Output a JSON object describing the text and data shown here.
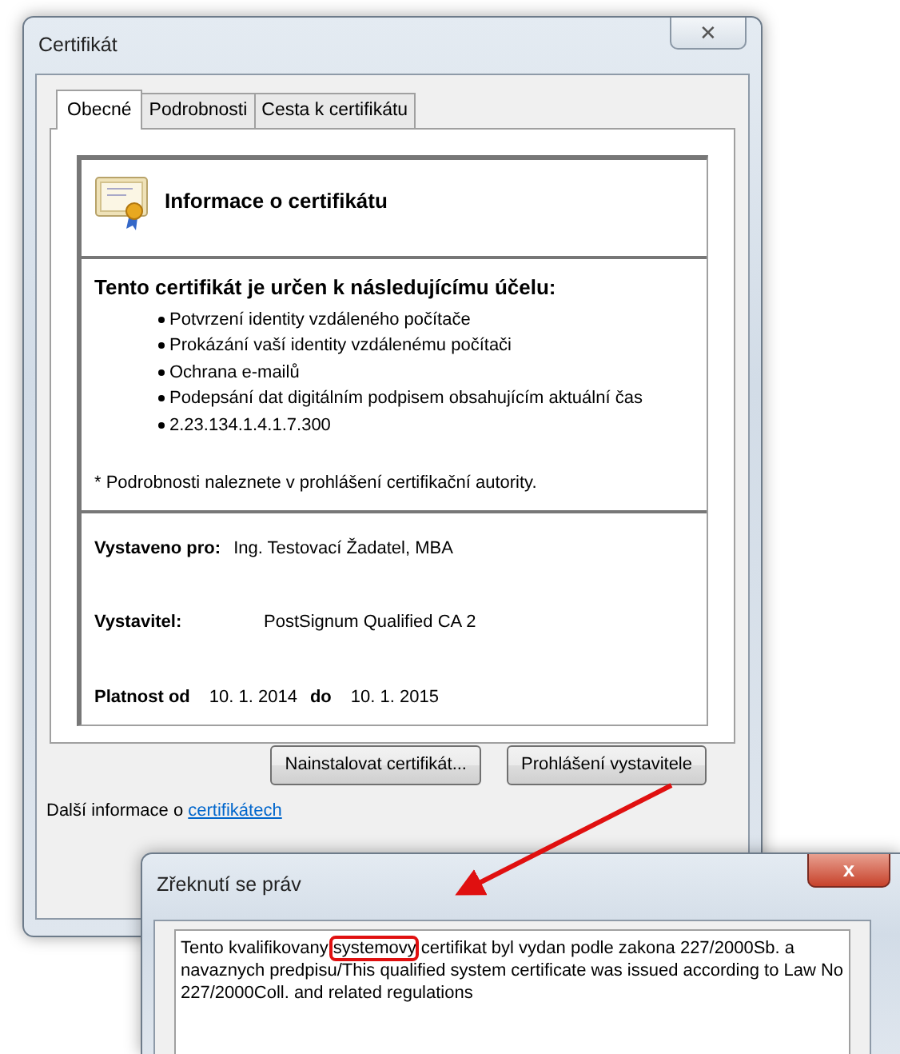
{
  "window": {
    "title": "Certifikát",
    "close": "✕"
  },
  "tabs": [
    {
      "label": "Obecné",
      "selected": true
    },
    {
      "label": "Podrobnosti",
      "selected": false
    },
    {
      "label": "Cesta k certifikátu",
      "selected": false
    }
  ],
  "info": {
    "heading": "Informace o certifikátu",
    "purpose_title": "Tento certifikát je určen k následujícímu účelu:",
    "purposes": [
      "Potvrzení identity vzdáleného počítače",
      "Prokázání vaší identity vzdálenému počítači",
      "Ochrana e-mailů",
      "Podepsání dat digitálním podpisem obsahujícím aktuální čas",
      "2.23.134.1.4.1.7.300"
    ],
    "note": "* Podrobnosti naleznete v prohlášení certifikační autority.",
    "issued_to_label": "Vystaveno pro:",
    "issued_to": "Ing. Testovací Žadatel, MBA",
    "issuer_label": "Vystavitel:",
    "issuer": "PostSignum Qualified CA 2",
    "valid_from_label": "Platnost od",
    "valid_from": "10. 1. 2014",
    "valid_to_label": "do",
    "valid_to": "10. 1. 2015"
  },
  "buttons": [
    "Nainstalovat certifikát...",
    "Prohlášení vystavitele"
  ],
  "more_info": {
    "text": "Další informace o",
    "link": "certifikátech"
  },
  "disclaimer_window": {
    "title": "Zřeknutí se práv",
    "close": "x",
    "text_before": "Tento kvalifikovany ",
    "text_highlight": "systemovy",
    "text_after": " certifikat byl vydan podle zakona 227/2000Sb. a navaznych predpisu/This qualified system certificate was issued according to Law No 227/2000Coll. and related regulations"
  }
}
